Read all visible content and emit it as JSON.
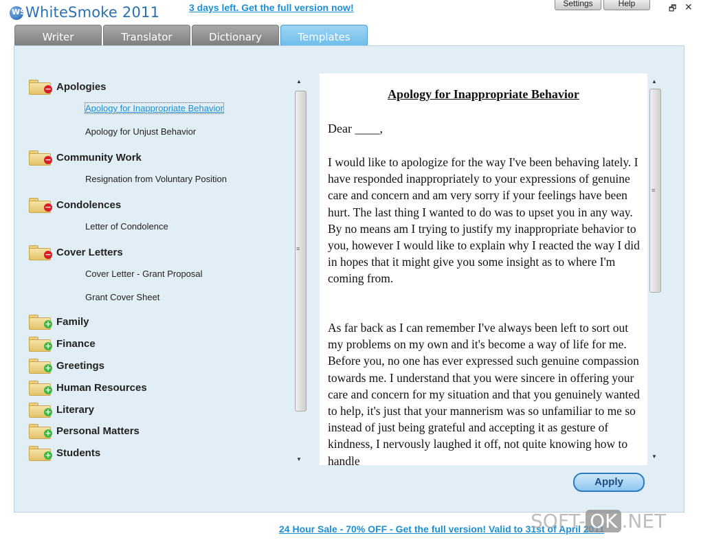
{
  "window": {
    "title": "WhiteSmoke 2011",
    "logo_text": "WS",
    "promo_top": "3 days left. Get the full version now!",
    "settings_label": "Settings",
    "help_label": "Help",
    "restore_glyph": "🗗",
    "close_glyph": "✕"
  },
  "tabs": [
    {
      "label": "Writer"
    },
    {
      "label": "Translator"
    },
    {
      "label": "Dictionary"
    },
    {
      "label": "Templates",
      "active": true
    }
  ],
  "tree": {
    "categories": [
      {
        "label": "Apologies",
        "expanded": true,
        "items": [
          "Apology for Inappropriate Behavior",
          "Apology for Unjust Behavior"
        ]
      },
      {
        "label": "Community Work",
        "expanded": true,
        "items": [
          "Resignation from Voluntary Position"
        ]
      },
      {
        "label": "Condolences",
        "expanded": true,
        "items": [
          "Letter of Condolence"
        ]
      },
      {
        "label": "Cover Letters",
        "expanded": true,
        "items": [
          "Cover Letter - Grant Proposal",
          "Grant Cover Sheet"
        ]
      },
      {
        "label": "Family",
        "expanded": false
      },
      {
        "label": "Finance",
        "expanded": false
      },
      {
        "label": "Greetings",
        "expanded": false
      },
      {
        "label": "Human Resources",
        "expanded": false
      },
      {
        "label": "Literary",
        "expanded": false
      },
      {
        "label": "Personal Matters",
        "expanded": false
      },
      {
        "label": "Students",
        "expanded": false
      }
    ],
    "selected_item": "Apology for Inappropriate Behavior",
    "badge_collapse": "−",
    "badge_expand": "+"
  },
  "document": {
    "title": "Apology for Inappropriate Behavior",
    "greeting": "Dear ____,",
    "paragraph_1": "I would like to apologize for the way I've been behaving lately. I have responded inappropriately to your expressions of genuine care and concern and am very sorry if your feelings have been hurt. The last thing I wanted to do was to upset you in any way. By no means am I trying to justify my inappropriate behavior to you, however I would like to explain why I reacted the way I did in hopes that it might give you some insight as to where I'm coming from.",
    "paragraph_2": "As far back as I can remember I've always been left to sort out my problems on my own and it's become a way of life for me. Before you, no one has ever expressed such genuine compassion towards me. I understand that you were sincere in offering your care and concern for my situation and that you genuinely wanted to help, it's just that your mannerism was so unfamiliar to me so instead of just being grateful and accepting it as gesture of kindness, I nervously laughed it off, not quite knowing how to handle"
  },
  "apply_label": "Apply",
  "promo_bottom": "24 Hour Sale - 70% OFF - Get the full version! Valid to 31st of April 2011",
  "watermark": {
    "left": "SOFT-",
    "ok": "OK",
    "right": ".NET"
  }
}
